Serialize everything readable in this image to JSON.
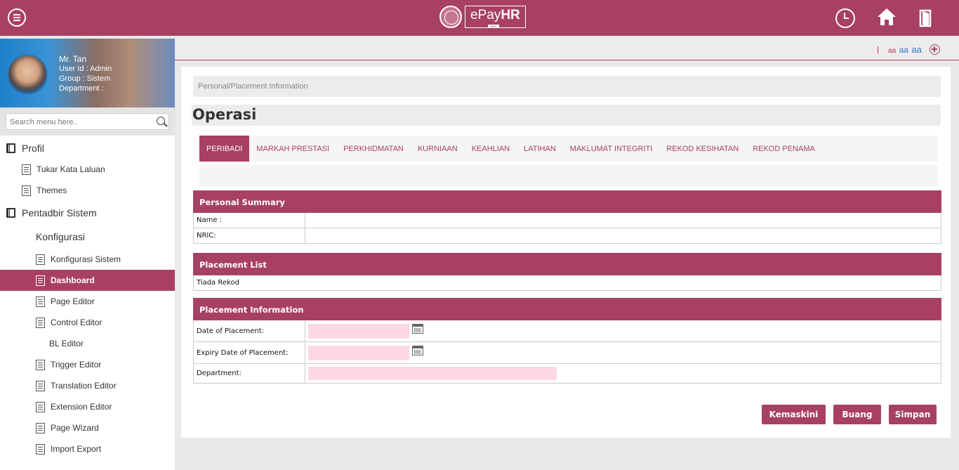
{
  "app": {
    "logo_prefix": "ePay",
    "logo_suffix": "HR",
    "logo_tag": "MPK"
  },
  "colors": {
    "brand": "#a84062",
    "input_bg": "#fdd8e3"
  },
  "header": {
    "icons": [
      "menu-icon",
      "history-icon",
      "home-icon",
      "logout-icon"
    ]
  },
  "user": {
    "name": "Mr. Tan",
    "user_id": "User Id : Admin",
    "group": "Group : Sistem",
    "department": "Department :"
  },
  "search": {
    "placeholder": "Search menu here.."
  },
  "sidebar": {
    "profil": "Profil",
    "tukar_kata_laluan": "Tukar Kata Laluan",
    "themes": "Themes",
    "pentadbir_sistem": "Pentadbir Sistem",
    "konfigurasi": "Konfigurasi",
    "konfigurasi_sistem": "Konfigurasi Sistem",
    "dashboard": "Dashboard",
    "page_editor": "Page Editor",
    "control_editor": "Control Editor",
    "bl_editor": "BL Editor",
    "trigger_editor": "Trigger Editor",
    "translation_editor": "Translation Editor",
    "extension_editor": "Extension Editor",
    "page_wizard": "Page Wizard",
    "import_export": "Import Export"
  },
  "toolbar": {
    "font_small": "aa",
    "font_medium": "aa",
    "font_large": "aa"
  },
  "breadcrumb": "Personal/Placement Information",
  "page_title": "Operasi",
  "tabs": [
    "PERIBADI",
    "MARKAH PRESTASI",
    "PERKHIDMATAN",
    "KURNIAAN",
    "KEAHLIAN",
    "LATIHAN",
    "MAKLUMAT INTEGRITI",
    "REKOD KESIHATAN",
    "REKOD PENAMA"
  ],
  "personal_summary": {
    "title": "Personal Summary",
    "name_label": "Name :",
    "name_value": "",
    "nric_label": "NRIC:",
    "nric_value": ""
  },
  "placement_list": {
    "title": "Placement List",
    "empty_text": "Tiada Rekod"
  },
  "placement_info": {
    "title": "Placement Information",
    "date_label": "Date of Placement:",
    "date_value": "",
    "expiry_label": "Expiry Date of Placement:",
    "expiry_value": "",
    "department_label": "Department:",
    "department_value": ""
  },
  "buttons": {
    "update": "Kemaskini",
    "discard": "Buang",
    "save": "Simpan"
  }
}
